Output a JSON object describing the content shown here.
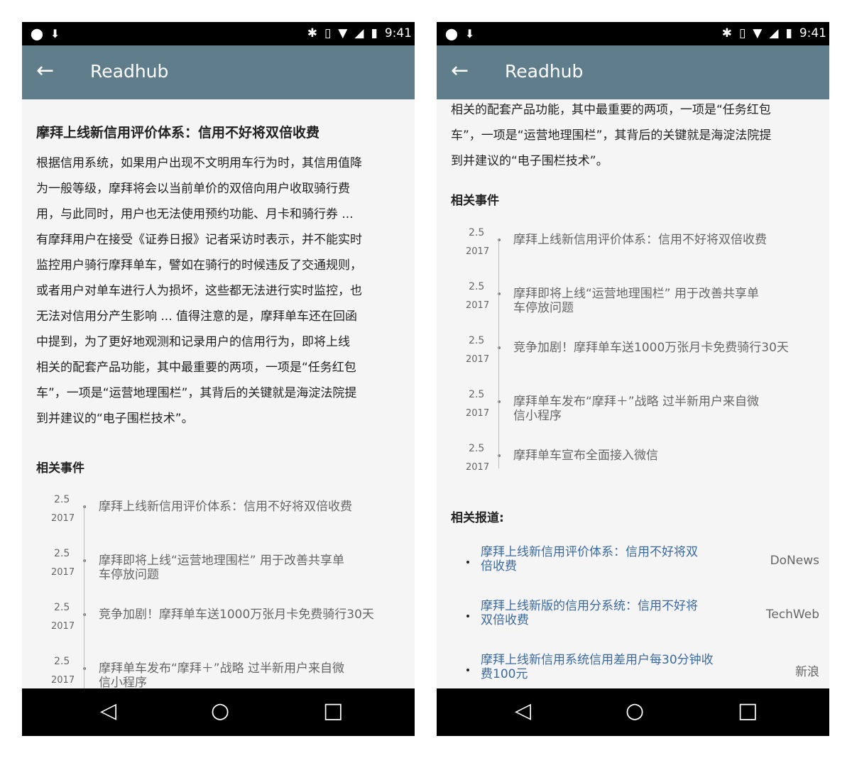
{
  "status": {
    "time": "9:41"
  },
  "appbar": {
    "back": "←",
    "title": "Readhub"
  },
  "nav": {
    "back": "◁",
    "home": "○",
    "recents": "□"
  },
  "article": {
    "title": "摩拜上线新信用评价体系：信用不好将双倍收费",
    "lines": [
      "根据信用系统，如果用户出现不文明用车行为时，其信用值降",
      "为一般等级，摩拜将会以当前单价的双倍向用户收取骑行费",
      "用，与此同时，用户也无法使用预约功能、月卡和骑行券 ...",
      "有摩拜用户在接受《证券日报》记者采访时表示，并不能实时",
      "监控用户骑行摩拜单车，譬如在骑行的时候违反了交通规则，",
      "或者用户对单车进行人为损坏，这些都无法进行实时监控，也",
      "无法对信用分产生影响 ... 值得注意的是，摩拜单车还在回函",
      "中提到，为了更好地观测和记录用户的信用行为，即将上线",
      "相关的配套产品功能，其中最重要的两项，一项是“任务红包",
      "车”，一项是“运营地理围栏”，其背后的关键就是海淀法院提",
      "到并建议的“电子围栏技术”。"
    ]
  },
  "related_events": {
    "heading": "相关事件",
    "items": [
      {
        "md": "2.5",
        "year": "2017",
        "text": "摩拜上线新信用评价体系：信用不好将双倍收费"
      },
      {
        "md": "2.5",
        "year": "2017",
        "text": "摩拜即将上线“运营地理围栏” 用于改善共享单车停放问题"
      },
      {
        "md": "2.5",
        "year": "2017",
        "text": "竞争加剧！摩拜单车送1000万张月卡免费骑行30天"
      },
      {
        "md": "2.5",
        "year": "2017",
        "text": "摩拜单车发布“摩拜＋”战略 过半新用户来自微信小程序"
      },
      {
        "md": "2.5",
        "year": "2017",
        "text": "摩拜单车宣布全面接入微信"
      }
    ]
  },
  "related_reports": {
    "heading": "相关报道:",
    "items": [
      {
        "title": "摩拜上线新信用评价体系：信用不好将双倍收费",
        "source": "DoNews"
      },
      {
        "title": "摩拜上线新版的信用分系统：信用不好将双倍收费",
        "source": "TechWeb"
      },
      {
        "title": "摩拜上线新信用系统信用差用户每30分钟收费100元",
        "source": "新浪"
      }
    ]
  }
}
